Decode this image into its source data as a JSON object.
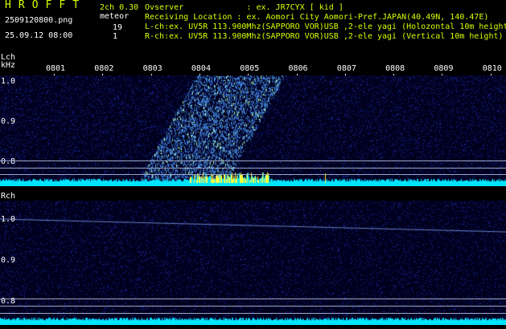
{
  "header": {
    "title": "H R O F F T",
    "filename": "2509120800.png",
    "datetime": "25.09.12 08:00",
    "mode": "2ch 0.30",
    "meteor_label": "meteor",
    "count_lch": "19",
    "count_rch": "1",
    "observer": "Ovserver             : ex. JR7CYX [ kid ]",
    "location": "Receiving Location : ex. Aomori City Aomori-Pref.JAPAN(40.49N, 140.47E)",
    "lch_info": "L-ch:ex. UV5R 113.900Mhz(SAPPORO VOR)USB ,2-ele yagi (Holozontal 10m height",
    "rch_info": "R-ch:ex. UV5R 113.900Mhz(SAPPORO VOR)USB ,2-ele yagi (Vertical 10m height)"
  },
  "lch": {
    "label": "Lch",
    "unit": "kHz",
    "time_ticks": [
      "0801",
      "0802",
      "0803",
      "0804",
      "0805",
      "0806",
      "0807",
      "0808",
      "0809",
      "0810"
    ],
    "freq_labels": [
      "1.0",
      "0.9",
      "0.8"
    ]
  },
  "rch": {
    "label": "Rch",
    "freq_labels": [
      "1.0",
      "0.9",
      "0.8"
    ]
  },
  "colors": {
    "background": "#000000",
    "accent_text": "#d8ff00",
    "noise_floor": "#00e5ff",
    "meteor_echo": "#ffff40"
  }
}
